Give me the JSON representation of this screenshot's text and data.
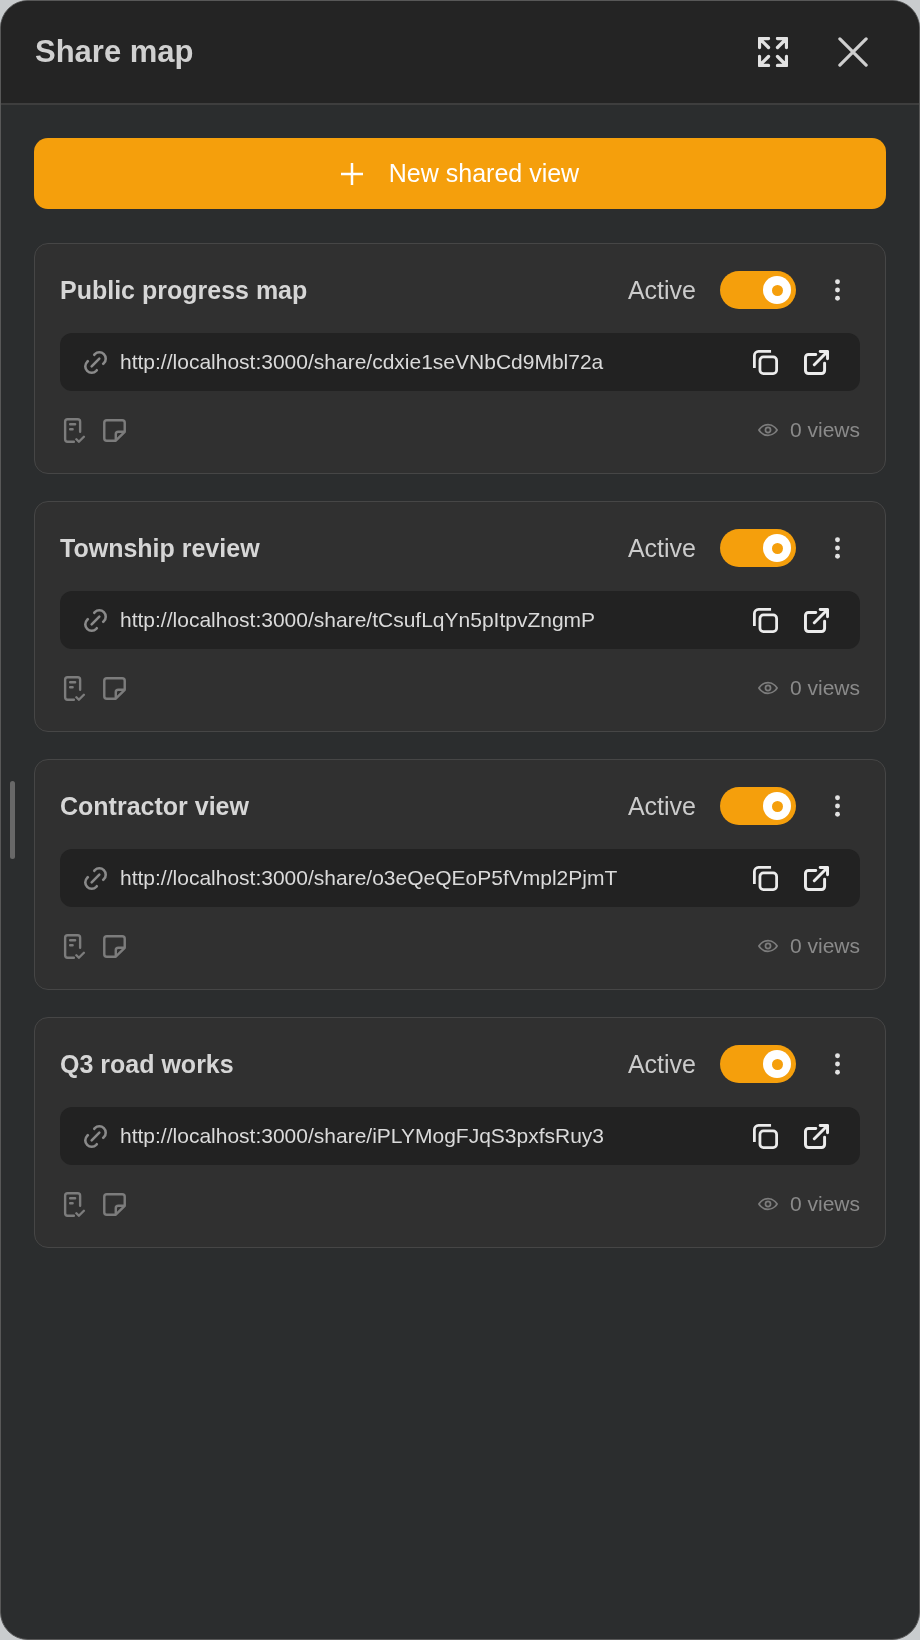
{
  "header": {
    "title": "Share map"
  },
  "new_view_button": {
    "label": "New shared view"
  },
  "shared_views": [
    {
      "name": "Public progress map",
      "status_label": "Active",
      "active": true,
      "url": "http://localhost:3000/share/cdxie1seVNbCd9Mbl72a",
      "views": "0 views"
    },
    {
      "name": "Township review",
      "status_label": "Active",
      "active": true,
      "url": "http://localhost:3000/share/tCsufLqYn5pItpvZngmP",
      "views": "0 views"
    },
    {
      "name": "Contractor view",
      "status_label": "Active",
      "active": true,
      "url": "http://localhost:3000/share/o3eQeQEoP5fVmpl2PjmT",
      "views": "0 views"
    },
    {
      "name": "Q3 road works",
      "status_label": "Active",
      "active": true,
      "url": "http://localhost:3000/share/iPLYMogFJqS3pxfsRuy3",
      "views": "0 views"
    }
  ]
}
